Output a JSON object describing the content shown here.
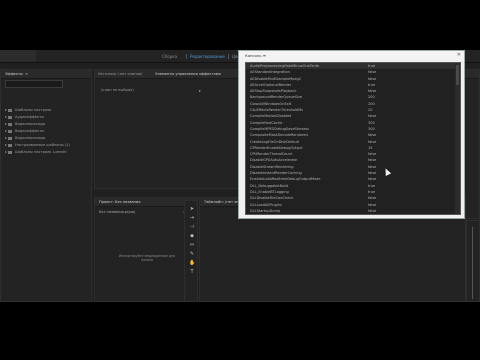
{
  "workspace_tabs": [
    "Сборка",
    "Редактирование",
    "Цвет",
    "Эффекты",
    "Звук"
  ],
  "active_workspace_index": 1,
  "panels": {
    "effects": {
      "tab": "Эффекты",
      "count": "≡"
    },
    "source": {
      "tabs": [
        "Источник: (нет клипов)",
        "Элементы управления эффектами"
      ],
      "empty_text": "(клип не выбран)"
    },
    "program": {
      "tab": "Программа: (нет эпизодов)"
    },
    "project": {
      "tab": "Проект: Без названия",
      "search": "Без названия.prproj",
      "hint": "Импортируйте медиаданные для начала"
    },
    "timeline": {
      "tab": "Таймлайн: (нет эпизодов)"
    }
  },
  "tree_items": [
    "Шаблоны настроек",
    "Аудиоэффекты",
    "Видеопереходы",
    "Видеоэффекты",
    "Видеопереходы",
    "Настраиваемые шаблоны (1)",
    "Шаблоны настроек Lumetri"
  ],
  "dialog": {
    "title": "Консоль  ≡",
    "rows": [
      {
        "k": "AudioPreprocessingRateMinusOneTenth",
        "v": "true"
      },
      {
        "k": "AEStandardIntegration",
        "v": "false"
      },
      {
        "k": "AEDisableMultiSampleMpeg2",
        "v": "false"
      },
      {
        "k": "AEAccelOptionalRender",
        "v": "true"
      },
      {
        "k": "AEStopSnapshotsPlayback",
        "v": "false"
      },
      {
        "k": "BackgroundRenderQueueSize",
        "v": "200"
      },
      {
        "k": "CloseAllWindowsOnExit",
        "v": "200"
      },
      {
        "k": "ClipEffectsRenderThresholdMs",
        "v": "20"
      },
      {
        "k": "CompileMotionDisabled",
        "v": "false"
      },
      {
        "k": "CompileFastCache",
        "v": "300"
      },
      {
        "k": "CompileMPEGDebugSaveStreams",
        "v": "300"
      },
      {
        "k": "CompositeMaskDecodeRendered",
        "v": "false"
      },
      {
        "k": "CreateLogFileOnDiskDefault",
        "v": "false"
      },
      {
        "k": "CPRenderEnableDebugOutput",
        "v": "15"
      },
      {
        "k": "CPURenderThreadCount",
        "v": "false"
      },
      {
        "k": "DisableGPUAutoAccelerate",
        "v": "false"
      },
      {
        "k": "DisableStreamRendering",
        "v": "false"
      },
      {
        "k": "DisableInstantRenderCaching",
        "v": "false"
      },
      {
        "k": "EnableAudioRealtimeDebugOutputMode",
        "v": "false"
      },
      {
        "k": "DLL_DebuggableBuild",
        "v": "true"
      },
      {
        "k": "DLL_EnableBTLogging",
        "v": "true"
      },
      {
        "k": "DLLDisableFileSizeCheck",
        "v": "false"
      },
      {
        "k": "DLLLoadAllPlugins",
        "v": "false"
      },
      {
        "k": "DLLStartupDump",
        "v": "false"
      }
    ]
  }
}
